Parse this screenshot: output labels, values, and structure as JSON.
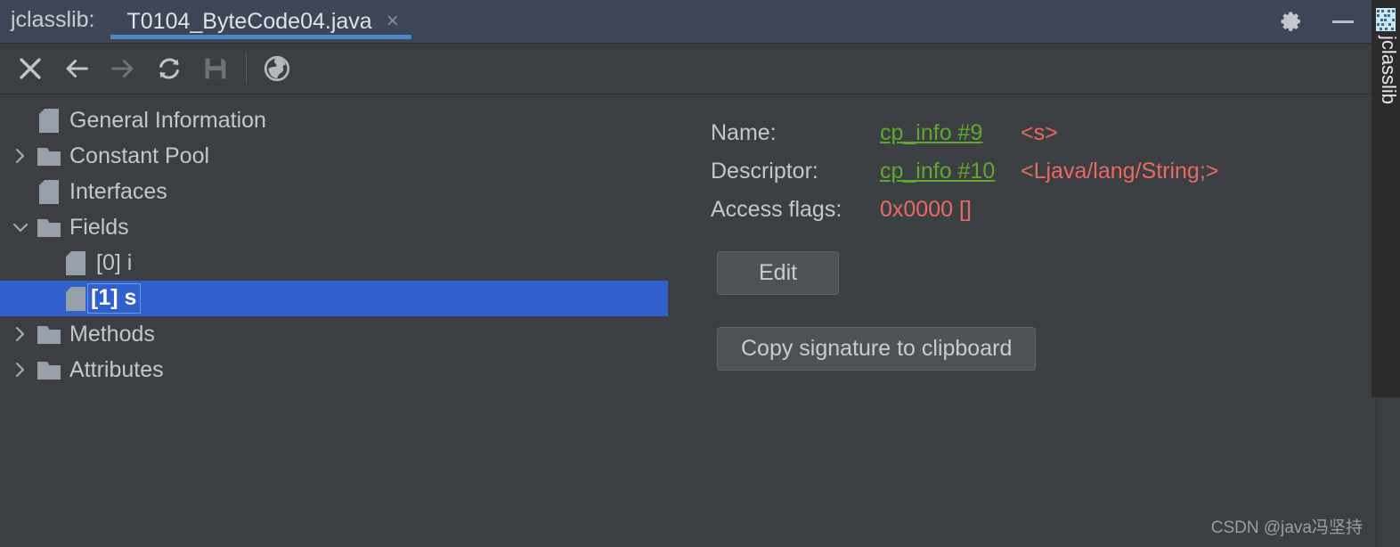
{
  "window": {
    "app_name": "jclasslib:",
    "tab": {
      "label": "T0104_ByteCode04.java",
      "close_glyph": "×"
    },
    "controls": {
      "settings_icon": "gear-icon",
      "minimize_label": "—"
    },
    "accent_color": "#4a88c7",
    "titlebar_color": "#3c4656"
  },
  "toolbar": {
    "buttons": [
      {
        "name": "close-icon",
        "glyph": "×",
        "enabled": true
      },
      {
        "name": "back-arrow-icon",
        "glyph": "←",
        "enabled": true
      },
      {
        "name": "forward-arrow-icon",
        "glyph": "→",
        "enabled": false
      },
      {
        "name": "reload-icon",
        "glyph": "⟳",
        "enabled": true
      },
      {
        "name": "save-icon",
        "glyph": "💾",
        "enabled": false
      },
      {
        "name": "browse-globe-icon",
        "glyph": "🌐",
        "enabled": true
      }
    ]
  },
  "tree": {
    "items": [
      {
        "label": "General Information",
        "icon": "file-icon",
        "twisty": "none",
        "depth": 1,
        "selected": false
      },
      {
        "label": "Constant Pool",
        "icon": "folder-icon",
        "twisty": "collapsed",
        "depth": 0,
        "selected": false
      },
      {
        "label": "Interfaces",
        "icon": "file-icon",
        "twisty": "none",
        "depth": 1,
        "selected": false
      },
      {
        "label": "Fields",
        "icon": "folder-icon",
        "twisty": "expanded",
        "depth": 0,
        "selected": false
      },
      {
        "label": "[0] i",
        "icon": "file-icon",
        "twisty": "none",
        "depth": 2,
        "selected": false
      },
      {
        "label": "[1] s",
        "icon": "file-icon",
        "twisty": "none",
        "depth": 2,
        "selected": true
      },
      {
        "label": "Methods",
        "icon": "folder-icon",
        "twisty": "collapsed",
        "depth": 0,
        "selected": false
      },
      {
        "label": "Attributes",
        "icon": "folder-icon",
        "twisty": "collapsed",
        "depth": 0,
        "selected": false
      }
    ],
    "selection_color": "#2f60ce"
  },
  "detail": {
    "name_label": "Name:",
    "name_link": "cp_info #9",
    "name_value": "<s>",
    "descriptor_label": "Descriptor:",
    "descriptor_link": "cp_info #10",
    "descriptor_value": "<Ljava/lang/String;>",
    "access_flags_label": "Access flags:",
    "access_flags_value": "0x0000 []",
    "edit_button": "Edit",
    "copy_button": "Copy signature to clipboard",
    "link_color": "#5fa830",
    "value_color": "#e86a62"
  },
  "side_strip": {
    "label": "jclasslib",
    "icon": "binary-code-icon"
  },
  "watermark": "CSDN @java冯坚持"
}
